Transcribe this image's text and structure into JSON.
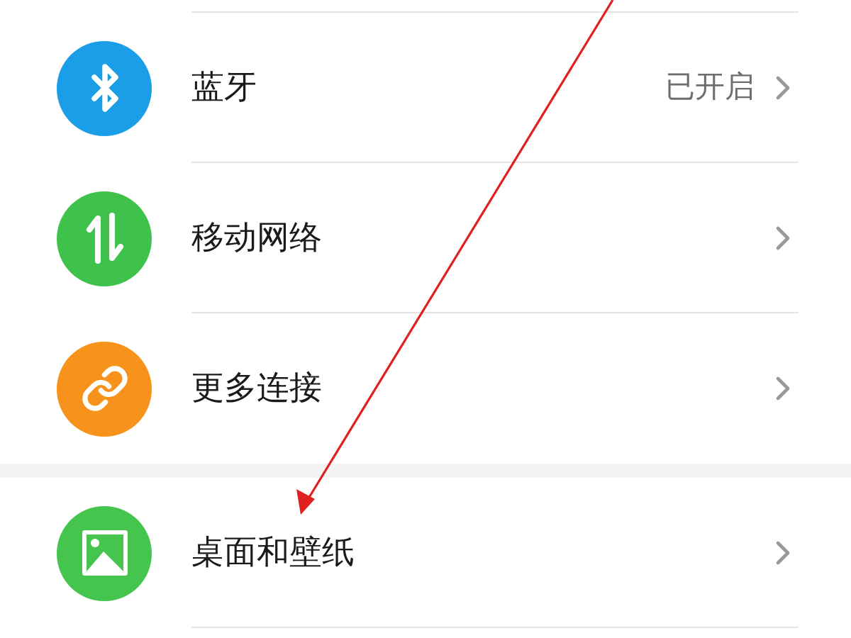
{
  "sections": [
    {
      "items": [
        {
          "kind": "bluetooth",
          "color": "#1b9ee8",
          "label": "蓝牙",
          "value": "已开启"
        },
        {
          "kind": "data",
          "color": "#3fc24b",
          "label": "移动网络"
        },
        {
          "kind": "link",
          "color": "#f7931d",
          "label": "更多连接"
        }
      ]
    },
    {
      "items": [
        {
          "kind": "wallpaper",
          "color": "#45c44e",
          "label": "桌面和壁纸"
        }
      ]
    }
  ]
}
